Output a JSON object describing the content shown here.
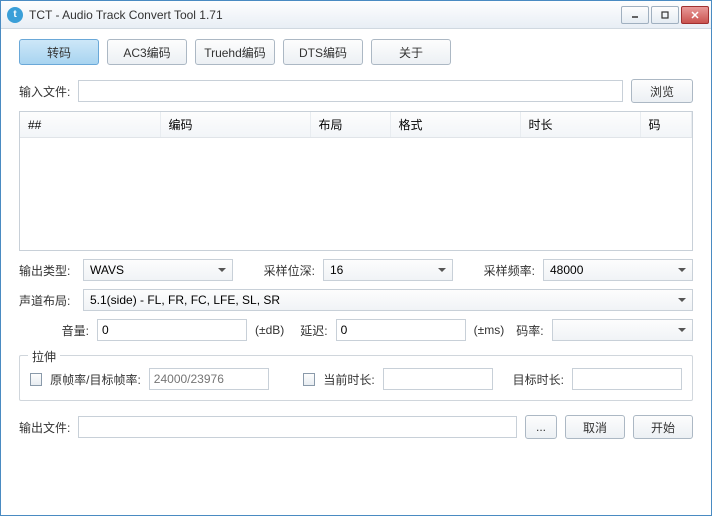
{
  "window": {
    "title": "TCT - Audio Track Convert Tool 1.71"
  },
  "tabs": [
    "转码",
    "AC3编码",
    "Truehd编码",
    "DTS编码",
    "关于"
  ],
  "labels": {
    "input_file": "输入文件:",
    "browse": "浏览",
    "output_type": "输出类型:",
    "sample_depth": "采样位深:",
    "sample_rate": "采样频率:",
    "channel_layout": "声道布局:",
    "volume": "音量:",
    "volume_unit": "(±dB)",
    "delay": "延迟:",
    "delay_unit": "(±ms)",
    "bitrate": "码率:",
    "stretch": "拉伸",
    "orig_target_fps": "原帧率/目标帧率:",
    "current_duration": "当前时长:",
    "target_duration": "目标时长:",
    "output_file": "输出文件:",
    "cancel": "取消",
    "start": "开始",
    "ellipsis": "..."
  },
  "columns": [
    "##",
    "编码",
    "布局",
    "格式",
    "时长",
    "码"
  ],
  "values": {
    "output_type": "WAVS",
    "sample_depth": "16",
    "sample_rate": "48000",
    "channel_layout": "5.1(side) - FL, FR, FC, LFE, SL, SR",
    "volume": "0",
    "delay": "0",
    "bitrate": "",
    "fps_placeholder": "24000/23976",
    "current_duration": "",
    "target_duration": "",
    "input_file": "",
    "output_file": ""
  }
}
